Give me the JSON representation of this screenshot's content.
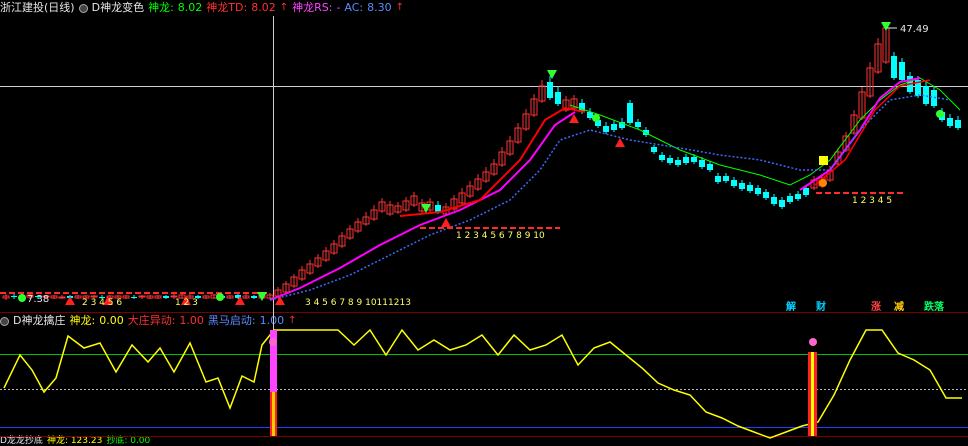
{
  "main_header": {
    "stock_name": "浙江建投(日线)",
    "indicator": "D神龙变色",
    "shenlong_label": "神龙:",
    "shenlong_value": "8.02",
    "shenlong_td_label": "神龙TD:",
    "shenlong_td_value": "8.02",
    "shenlong_rs_label": "神龙RS:",
    "shenlong_rs_value": "-",
    "ac_label": "AC:",
    "ac_value": "8.30",
    "up_arrow": "↑"
  },
  "sub_header": {
    "indicator": "D神龙擒庄",
    "shenlong_label": "神龙:",
    "shenlong_value": "0.00",
    "dazhuang_label": "大庄异动:",
    "dazhuang_value": "1.00",
    "heima_label": "黑马启动:",
    "heima_value": "1.00",
    "up_arrow": "↑"
  },
  "third_header": {
    "indicator": "D龙龙抄底",
    "items": [
      "神龙: 123.23",
      "抄底: 0.00"
    ]
  },
  "price_labels": {
    "high": "47.49",
    "low": "7.38"
  },
  "sequence_labels": {
    "seq_bottom_left_1": "2 3 4 5 6",
    "seq_bottom_left_2": "1 2 3",
    "seq_bottom_right": "3 4 5 6 7 8 9 10111213",
    "seq_mid": "1 2 3 4 5 6 7 8 9 10",
    "seq_right": "1 2 3 4 5"
  },
  "signal_tags": [
    "解",
    "财",
    "涨",
    "减",
    "跌落"
  ],
  "colors": {
    "up_candle": "#ff3232",
    "down_candle": "#00ffff",
    "ma_red": "#ff0000",
    "ma_magenta": "#ff00ff",
    "ma_green": "#00ff00",
    "ma_blue_dotted": "#3a6bff",
    "osc_line": "#ffff00",
    "crosshair": "#ffffff"
  }
}
